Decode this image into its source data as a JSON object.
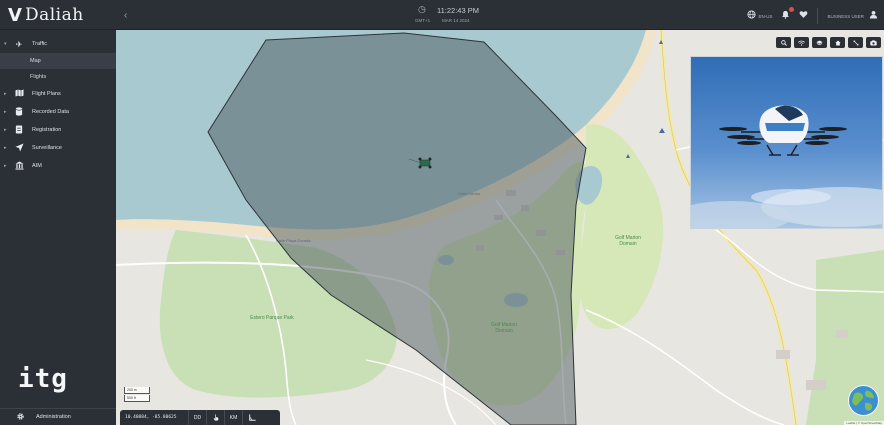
{
  "app": {
    "logo_mark": "V",
    "logo_name": "Daliah"
  },
  "header": {
    "time": "11:22:43 PM",
    "timezone": "GMT+1",
    "date": "MAR 14 2024",
    "language": "EN-US",
    "user": "BUSINESS USER"
  },
  "sidebar": {
    "items": [
      {
        "label": "Traffic",
        "icon": "plane-icon",
        "expanded": true,
        "sub": [
          {
            "label": "Map",
            "active": true
          },
          {
            "label": "Flights",
            "active": false
          }
        ]
      },
      {
        "label": "Flight Plans",
        "icon": "map-icon"
      },
      {
        "label": "Recorded Data",
        "icon": "database-icon"
      },
      {
        "label": "Registration",
        "icon": "registration-icon"
      },
      {
        "label": "Surveillance",
        "icon": "navigation-arrow-icon"
      },
      {
        "label": "AIM",
        "icon": "building-icon"
      }
    ],
    "brand": "itg",
    "admin_label": "Administration"
  },
  "map": {
    "labels": {
      "park_west": "Estero Parque Park",
      "golf_north": "Golf Marion Domain",
      "golf_south": "Golf Marion Domain",
      "road_coastal": "Calle Playa Dorada",
      "road_north": "Calle Centro"
    },
    "controls": [
      "search-icon",
      "wifi-icon",
      "layers-icon",
      "home-icon",
      "zoom-icon",
      "camera-icon"
    ],
    "scale": [
      "200 m",
      "500 ft"
    ],
    "coordinates": "10.40884, -85.80625",
    "coord_format": "DD",
    "distance_unit": "KM",
    "attribution": "Leaflet | © OpenStreetMap"
  },
  "colors": {
    "water": "#a9c9d0",
    "land": "#e8e6e0",
    "park": "#c9dfb6",
    "golf": "#d6e8b8",
    "geofence_fill": "#4d5960",
    "geofence_opacity": 0.5,
    "road": "#f5e9a6"
  }
}
